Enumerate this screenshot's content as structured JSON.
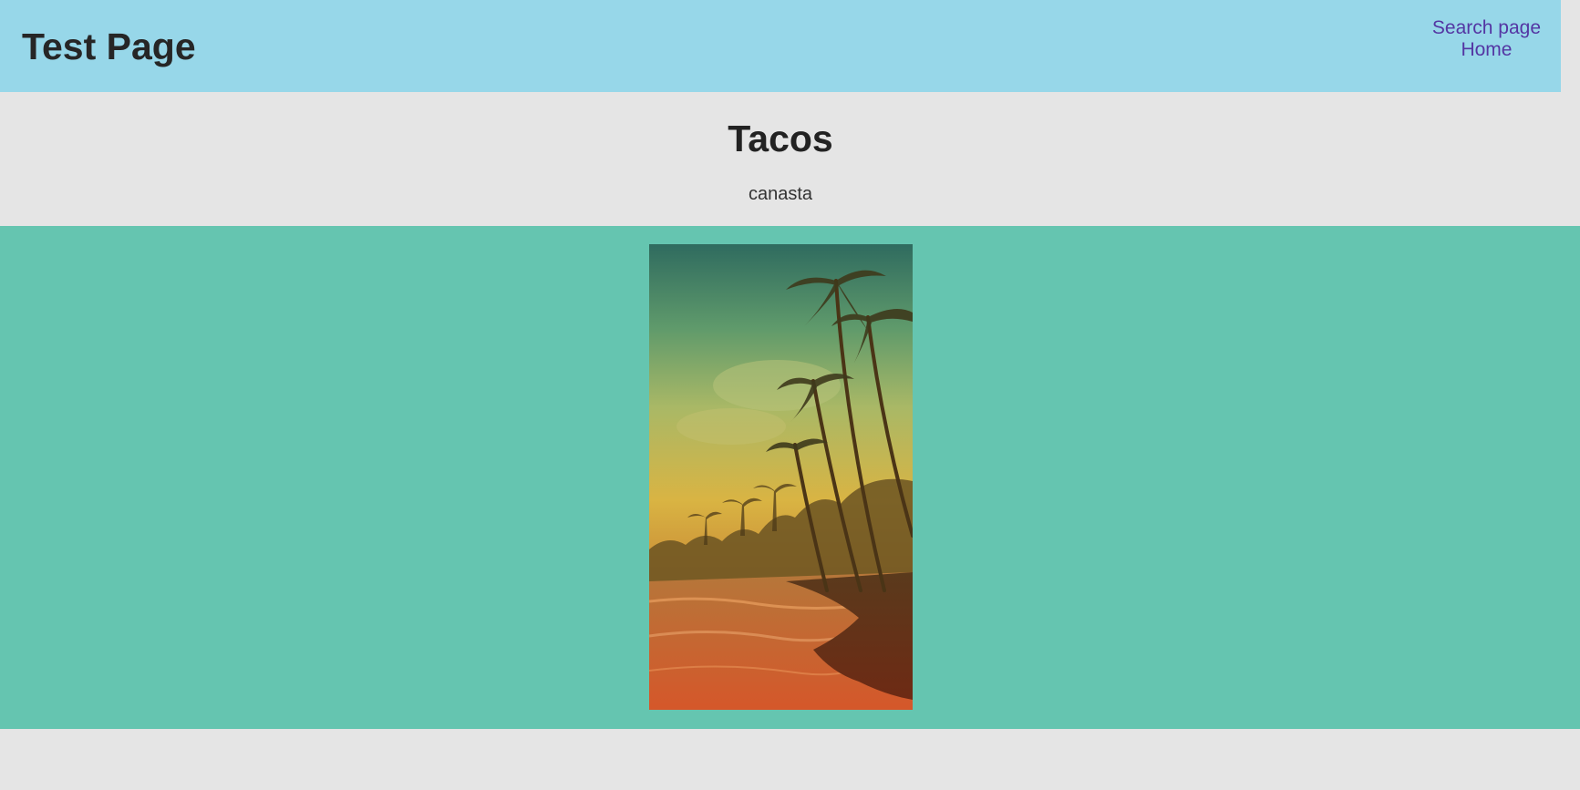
{
  "header": {
    "site_title": "Test Page",
    "nav": [
      {
        "label": "Search page"
      },
      {
        "label": "Home"
      }
    ],
    "background": "#97d7e9",
    "link_color": "#5436a3"
  },
  "hero": {
    "title": "Tacos",
    "subtitle": "canasta"
  },
  "gallery": {
    "background": "#65c5b0",
    "image": {
      "description_icon": "tropical-beach-photo"
    }
  }
}
